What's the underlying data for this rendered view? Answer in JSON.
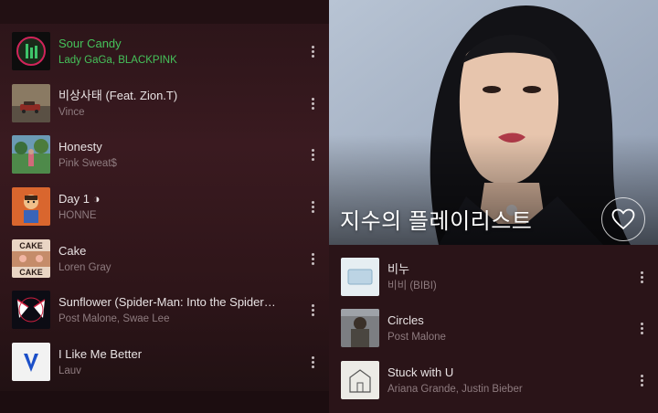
{
  "left_list": {
    "tracks": [
      {
        "title": "Sour Candy",
        "artist": "Lady GaGa, BLACKPINK",
        "active": true
      },
      {
        "title": "비상사태 (Feat. Zion.T)",
        "artist": "Vince",
        "active": false
      },
      {
        "title": "Honesty",
        "artist": "Pink Sweat$",
        "active": false
      },
      {
        "title": "Day 1 ◑",
        "artist": "HONNE",
        "active": false
      },
      {
        "title": "Cake",
        "artist": "Loren Gray",
        "active": false
      },
      {
        "title": "Sunflower (Spider-Man: Into the Spider…",
        "artist": "Post Malone, Swae Lee",
        "active": false
      },
      {
        "title": "I Like Me Better",
        "artist": "Lauv",
        "active": false
      }
    ]
  },
  "playlist": {
    "title": "지수의 플레이리스트",
    "tracks": [
      {
        "title": "비누",
        "artist": "비비 (BIBI)"
      },
      {
        "title": "Circles",
        "artist": "Post Malone"
      },
      {
        "title": "Stuck with U",
        "artist": "Ariana Grande, Justin Bieber"
      }
    ]
  },
  "album_art_text": {
    "cake_top": "CAKE",
    "cake_bottom": "CAKE"
  },
  "colors": {
    "active_green": "#45c25a",
    "background": "#2a1418"
  },
  "icons": {
    "more": "vertical-ellipsis",
    "favorite": "heart-outline"
  }
}
